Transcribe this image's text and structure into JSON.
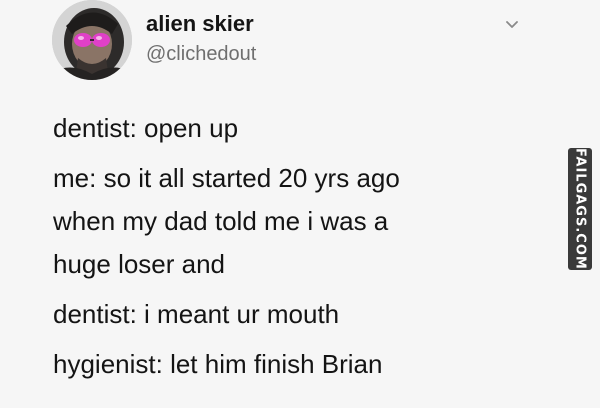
{
  "tweet": {
    "display_name": "alien skier",
    "handle": "@clichedout",
    "lines": [
      "dentist: open up",
      "me: so it all started 20 yrs ago",
      "when my dad told me i was a",
      "huge loser and",
      "dentist: i meant ur mouth",
      "hygienist: let him finish Brian"
    ]
  },
  "icons": {
    "avatar": "avatar-photo",
    "menu": "chevron-down-icon"
  },
  "watermark": {
    "text": "FAILGAGS.COM"
  },
  "colors": {
    "background": "#f6f6f6",
    "text": "#141414",
    "handle": "#6f6f6f",
    "watermark_bg": "#3a3a3a"
  }
}
